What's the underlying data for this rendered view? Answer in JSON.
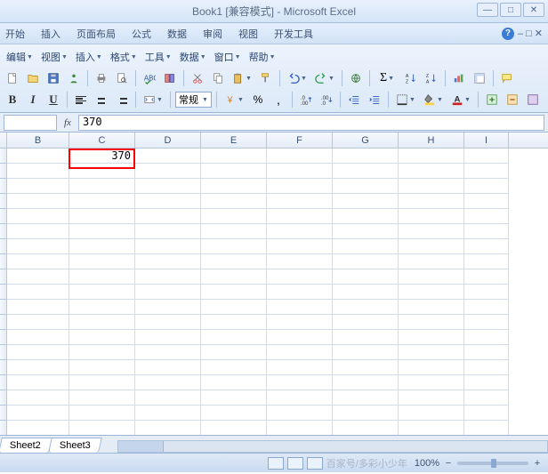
{
  "window": {
    "title": "Book1 [兼容模式] - Microsoft Excel"
  },
  "ribbon_tabs": [
    "开始",
    "插入",
    "页面布局",
    "公式",
    "数据",
    "审阅",
    "视图",
    "开发工具"
  ],
  "toolbar_menus_row1": [
    "编辑",
    "视图",
    "插入",
    "格式",
    "工具",
    "数据",
    "窗口",
    "帮助"
  ],
  "number_format": "常规",
  "formula_bar": {
    "namebox": "",
    "value": "370"
  },
  "columns": [
    "B",
    "C",
    "D",
    "E",
    "F",
    "G",
    "H",
    "I"
  ],
  "chart_data": {
    "type": "table",
    "active_cell": "C2",
    "cells": {
      "C2": 370
    }
  },
  "sheets": [
    "Sheet2",
    "Sheet3"
  ],
  "status": {
    "zoom": "100%",
    "watermark": "百家号/多彩小少年"
  }
}
